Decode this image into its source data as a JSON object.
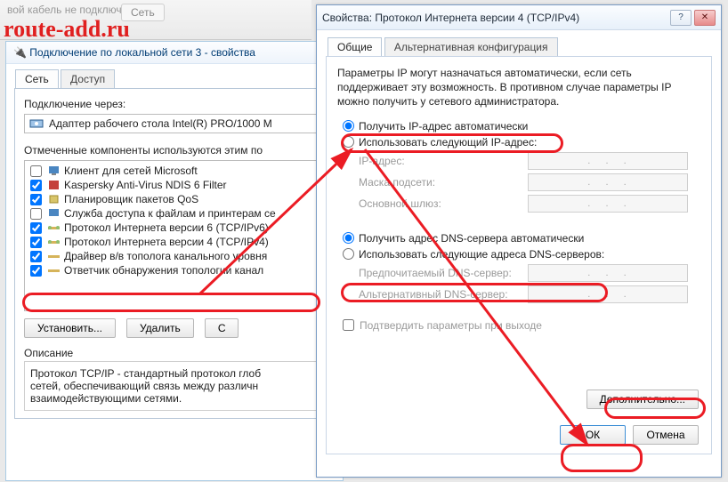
{
  "watermark": "route-add.ru",
  "bg": {
    "status": "вой кабель не подключен",
    "btn": "Сеть"
  },
  "adapter": {
    "title": "Подключение по локальной сети 3 - свойства",
    "tabs": [
      "Сеть",
      "Доступ"
    ],
    "connect_label": "Подключение через:",
    "adapter_name": "Адаптер рабочего стола Intel(R) PRO/1000 M",
    "used_label": "Отмеченные компоненты используются этим по",
    "items": [
      {
        "checked": false,
        "text": "Клиент для сетей Microsoft"
      },
      {
        "checked": true,
        "text": "Kaspersky Anti-Virus NDIS 6 Filter"
      },
      {
        "checked": true,
        "text": "Планировщик пакетов QoS"
      },
      {
        "checked": false,
        "text": "Служба доступа к файлам и принтерам се"
      },
      {
        "checked": true,
        "text": "Протокол Интернета версии 6 (TCP/IPv6)"
      },
      {
        "checked": true,
        "text": "Протокол Интернета версии 4 (TCP/IPv4)"
      },
      {
        "checked": true,
        "text": "Драйвер в/в тополога канального уровня"
      },
      {
        "checked": true,
        "text": "Ответчик обнаружения топологии канал"
      }
    ],
    "buttons": {
      "install": "Установить...",
      "remove": "Удалить",
      "props": "С"
    },
    "desc_title": "Описание",
    "desc_text": "Протокол TCP/IP - стандартный протокол глоб\nсетей, обеспечивающий связь между различн\nвзаимодействующими сетями."
  },
  "ipv4": {
    "title": "Свойства: Протокол Интернета версии 4 (TCP/IPv4)",
    "tabs": [
      "Общие",
      "Альтернативная конфигурация"
    ],
    "info": "Параметры IP могут назначаться автоматически, если сеть поддерживает эту возможность. В противном случае параметры IP можно получить у сетевого администратора.",
    "ip_auto": "Получить IP-адрес автоматически",
    "ip_manual": "Использовать следующий IP-адрес:",
    "ip_addr": "IP-адрес:",
    "mask": "Маска подсети:",
    "gateway": "Основной шлюз:",
    "dns_auto": "Получить адрес DNS-сервера автоматически",
    "dns_manual": "Использовать следующие адреса DNS-серверов:",
    "dns_pref": "Предпочитаемый DNS-сервер:",
    "dns_alt": "Альтернативный DNS-сервер:",
    "validate": "Подтвердить параметры при выходе",
    "advanced": "Дополнительно...",
    "ok": "ОК",
    "cancel": "Отмена"
  }
}
